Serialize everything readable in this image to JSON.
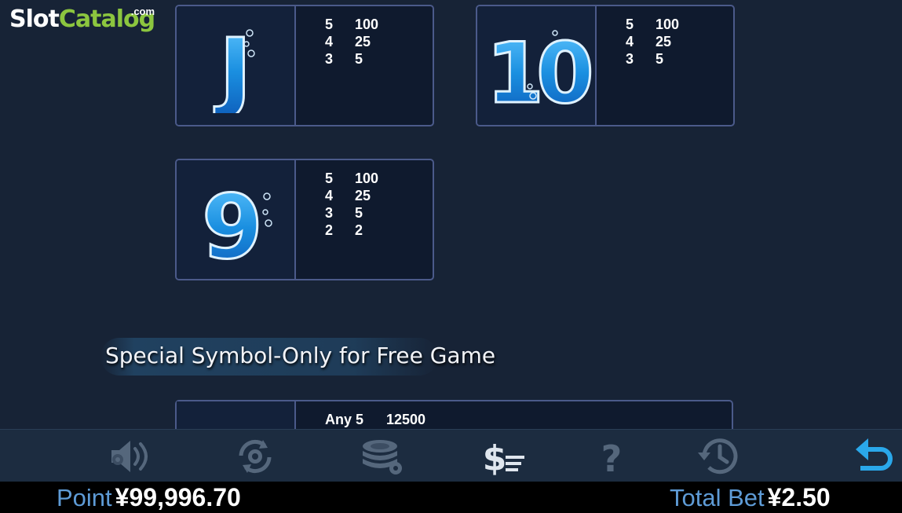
{
  "logo": {
    "main": "Slot",
    "accent": "Catalog",
    "suffix": ".com"
  },
  "symbols": [
    {
      "glyph": "J",
      "pays": [
        {
          "count": "5",
          "amount": "100"
        },
        {
          "count": "4",
          "amount": "25"
        },
        {
          "count": "3",
          "amount": "5"
        }
      ]
    },
    {
      "glyph": "10",
      "pays": [
        {
          "count": "5",
          "amount": "100"
        },
        {
          "count": "4",
          "amount": "25"
        },
        {
          "count": "3",
          "amount": "5"
        }
      ]
    },
    {
      "glyph": "9",
      "pays": [
        {
          "count": "5",
          "amount": "100"
        },
        {
          "count": "4",
          "amount": "25"
        },
        {
          "count": "3",
          "amount": "5"
        },
        {
          "count": "2",
          "amount": "2"
        }
      ]
    }
  ],
  "special": {
    "title": "Special Symbol-Only for Free Game",
    "pays": [
      {
        "count": "Any 5",
        "amount": "12500"
      }
    ]
  },
  "toolbar": {
    "icons": [
      "sound-settings-icon",
      "autoplay-settings-icon",
      "bet-settings-icon",
      "paytable-icon",
      "help-icon",
      "history-icon",
      "back-icon"
    ]
  },
  "balance": {
    "point_label": "Point",
    "point_value": "¥99,996.70",
    "bet_label": "Total Bet",
    "bet_value": "¥2.50"
  },
  "colors": {
    "background": "#172336",
    "card_border": "#4b5a8a",
    "accent_blue": "#1a8fe0",
    "back_arrow": "#2aa8ea",
    "logo_green": "#8cc63f",
    "balance_label": "#5e9bd6"
  }
}
